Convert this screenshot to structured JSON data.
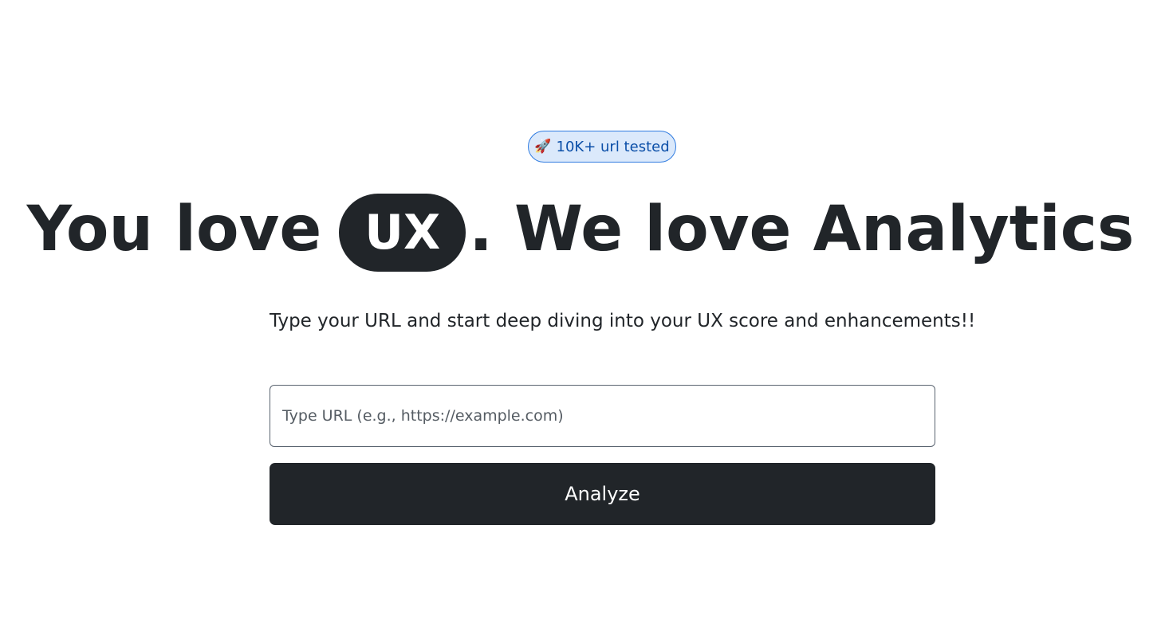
{
  "badge": {
    "icon": "rocket-icon",
    "emoji": "🚀",
    "text": "10K+ url tested",
    "colors": {
      "background": "#dbe9fb",
      "border": "#2f7be0",
      "text": "#0b4fa8"
    }
  },
  "headline": {
    "part1": "You love",
    "highlight": "UX",
    "part2": ". We love Analytics"
  },
  "subtitle": "Type your URL and start deep diving into your UX score and enhancements!!",
  "form": {
    "url_placeholder": "Type URL (e.g., https://example.com)",
    "url_value": "",
    "submit_label": "Analyze"
  },
  "colors": {
    "primary": "#212529",
    "background": "#ffffff"
  }
}
